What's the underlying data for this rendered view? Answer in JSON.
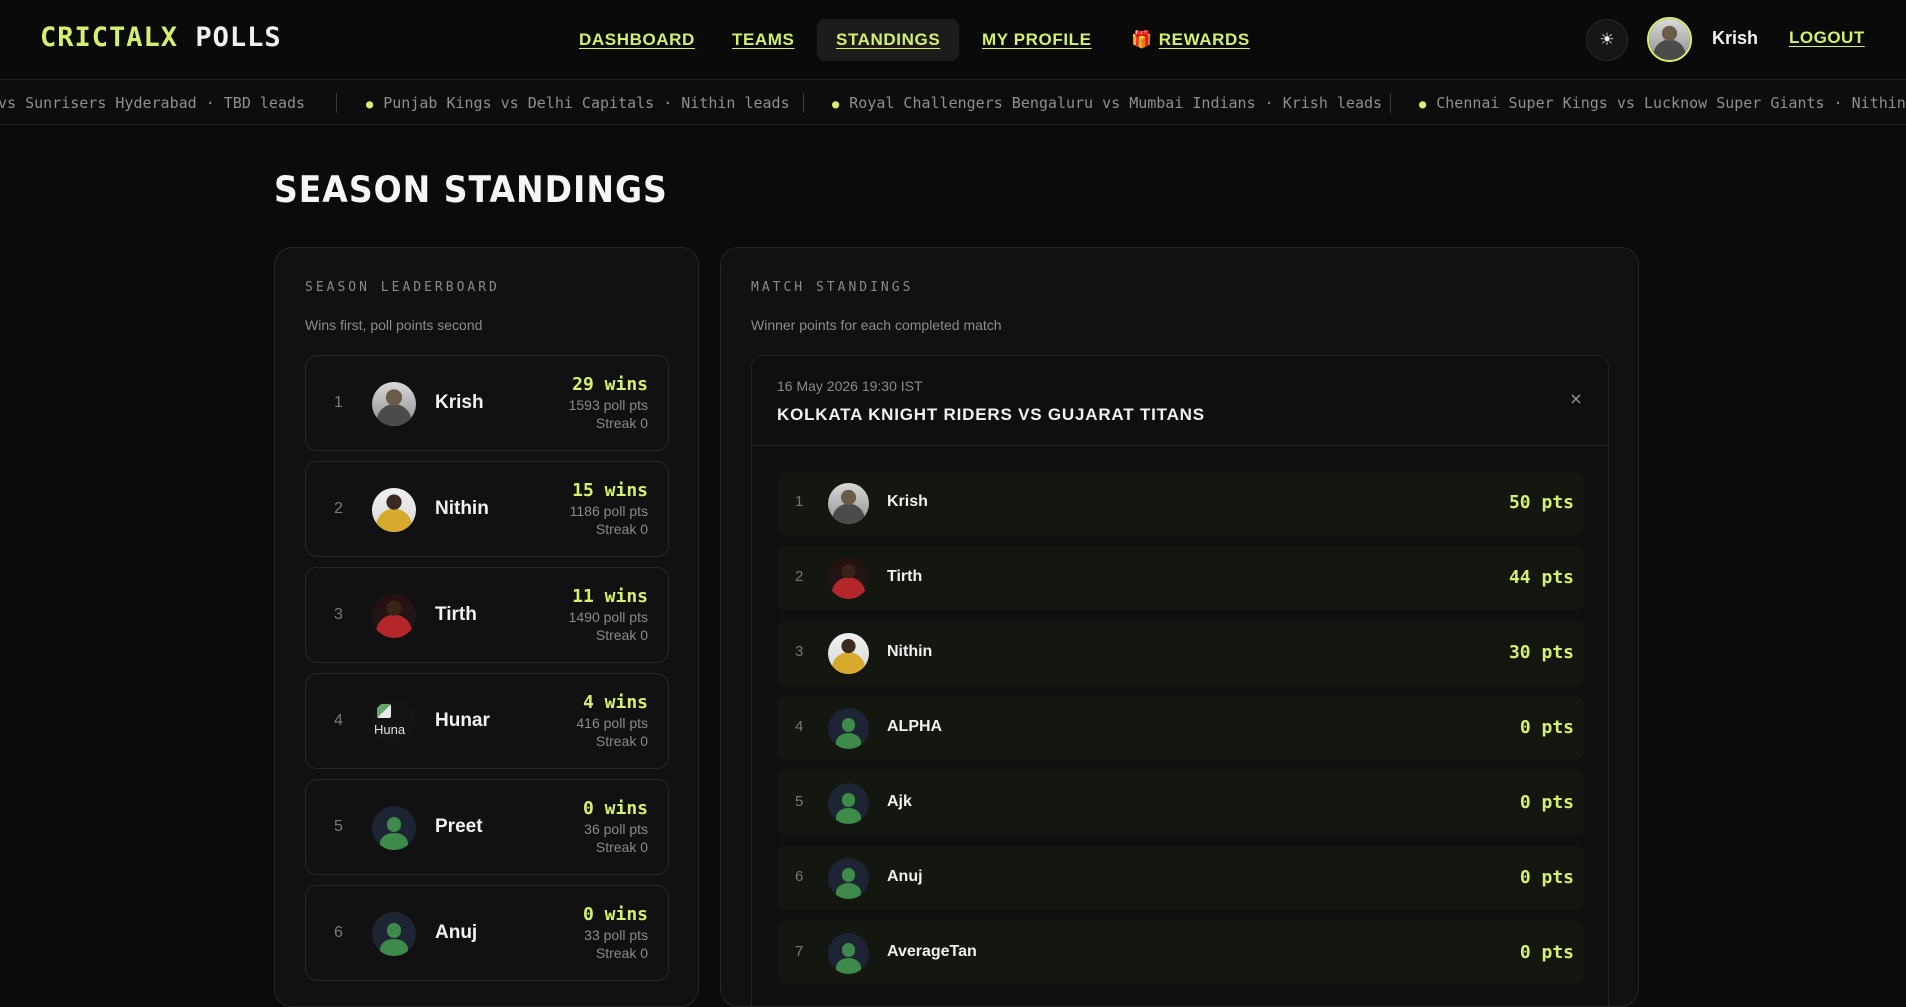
{
  "brand": {
    "accent": "CRICTALX",
    "rest": "POLLS"
  },
  "nav": {
    "items": [
      {
        "label": "DASHBOARD"
      },
      {
        "label": "TEAMS"
      },
      {
        "label": "STANDINGS"
      },
      {
        "label": "MY PROFILE"
      },
      {
        "label": "REWARDS",
        "icon": "🎁"
      }
    ],
    "active": "STANDINGS"
  },
  "user": {
    "name": "Krish",
    "logout_label": "LOGOUT",
    "theme_icon": "☀"
  },
  "ticker": [
    "vs Sunrisers Hyderabad · TBD leads",
    "Punjab Kings vs Delhi Capitals · Nithin leads",
    "Royal Challengers Bengaluru vs Mumbai Indians · Krish leads",
    "Chennai Super Kings vs Lucknow Super Giants · Nithin leads"
  ],
  "page_title": "SEASON STANDINGS",
  "leaderboard": {
    "label": "SEASON LEADERBOARD",
    "subtitle": "Wins first, poll points second",
    "rows": [
      {
        "rank": "1",
        "name": "Krish",
        "wins": "29 wins",
        "poll_pts": "1593 poll pts",
        "streak": "Streak 0"
      },
      {
        "rank": "2",
        "name": "Nithin",
        "wins": "15 wins",
        "poll_pts": "1186 poll pts",
        "streak": "Streak 0"
      },
      {
        "rank": "3",
        "name": "Tirth",
        "wins": "11 wins",
        "poll_pts": "1490 poll pts",
        "streak": "Streak 0"
      },
      {
        "rank": "4",
        "name": "Hunar",
        "wins": "4 wins",
        "poll_pts": "416 poll pts",
        "streak": "Streak 0",
        "avatar_alt": "Huna"
      },
      {
        "rank": "5",
        "name": "Preet",
        "wins": "0 wins",
        "poll_pts": "36 poll pts",
        "streak": "Streak 0"
      },
      {
        "rank": "6",
        "name": "Anuj",
        "wins": "0 wins",
        "poll_pts": "33 poll pts",
        "streak": "Streak 0"
      }
    ]
  },
  "match_standings": {
    "label": "MATCH STANDINGS",
    "subtitle": "Winner points for each completed match",
    "match": {
      "date": "16 May 2026 19:30 IST",
      "title": "KOLKATA KNIGHT RIDERS VS GUJARAT TITANS",
      "close_icon": "×",
      "rows": [
        {
          "rank": "1",
          "name": "Krish",
          "pts": "50 pts"
        },
        {
          "rank": "2",
          "name": "Tirth",
          "pts": "44 pts"
        },
        {
          "rank": "3",
          "name": "Nithin",
          "pts": "30 pts"
        },
        {
          "rank": "4",
          "name": "ALPHA",
          "pts": "0 pts"
        },
        {
          "rank": "5",
          "name": "Ajk",
          "pts": "0 pts"
        },
        {
          "rank": "6",
          "name": "Anuj",
          "pts": "0 pts"
        },
        {
          "rank": "7",
          "name": "AverageTan",
          "pts": "0 pts"
        }
      ]
    }
  },
  "colors": {
    "accent": "#d4f06e",
    "background": "#0b0b0b",
    "card": "#111111",
    "avatar_default": "#3e8a4a"
  }
}
